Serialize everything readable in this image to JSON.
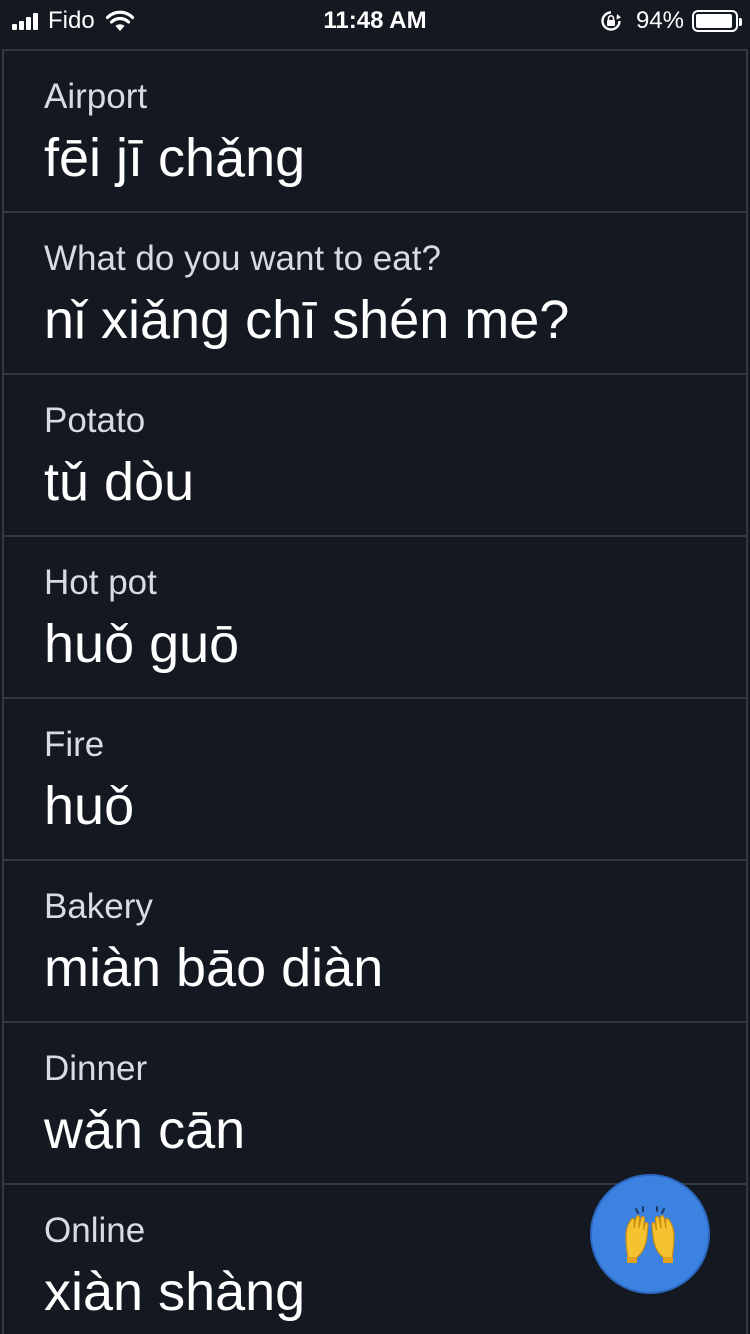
{
  "status_bar": {
    "carrier": "Fido",
    "time": "11:48 AM",
    "battery_percent": "94%",
    "battery_level": 0.94,
    "icons": [
      "signal-icon",
      "wifi-icon",
      "rotation-lock-icon",
      "battery-icon"
    ]
  },
  "phrases": [
    {
      "english": "Airport",
      "pinyin": "fēi jī chǎng"
    },
    {
      "english": "What do you want to eat?",
      "pinyin": "nǐ xiǎng chī shén me?"
    },
    {
      "english": "Potato",
      "pinyin": "tǔ dòu"
    },
    {
      "english": "Hot pot",
      "pinyin": "huǒ guō"
    },
    {
      "english": "Fire",
      "pinyin": "huǒ"
    },
    {
      "english": "Bakery",
      "pinyin": "miàn bāo diàn"
    },
    {
      "english": "Dinner",
      "pinyin": "wǎn cān"
    },
    {
      "english": "Online",
      "pinyin": "xiàn shàng"
    }
  ],
  "fab": {
    "icon": "raising-hands-icon",
    "color": "#3c82e0"
  },
  "colors": {
    "background": "#131821",
    "card_border": "#323844",
    "text_primary": "#ffffff",
    "text_secondary": "#d8dbe0"
  }
}
